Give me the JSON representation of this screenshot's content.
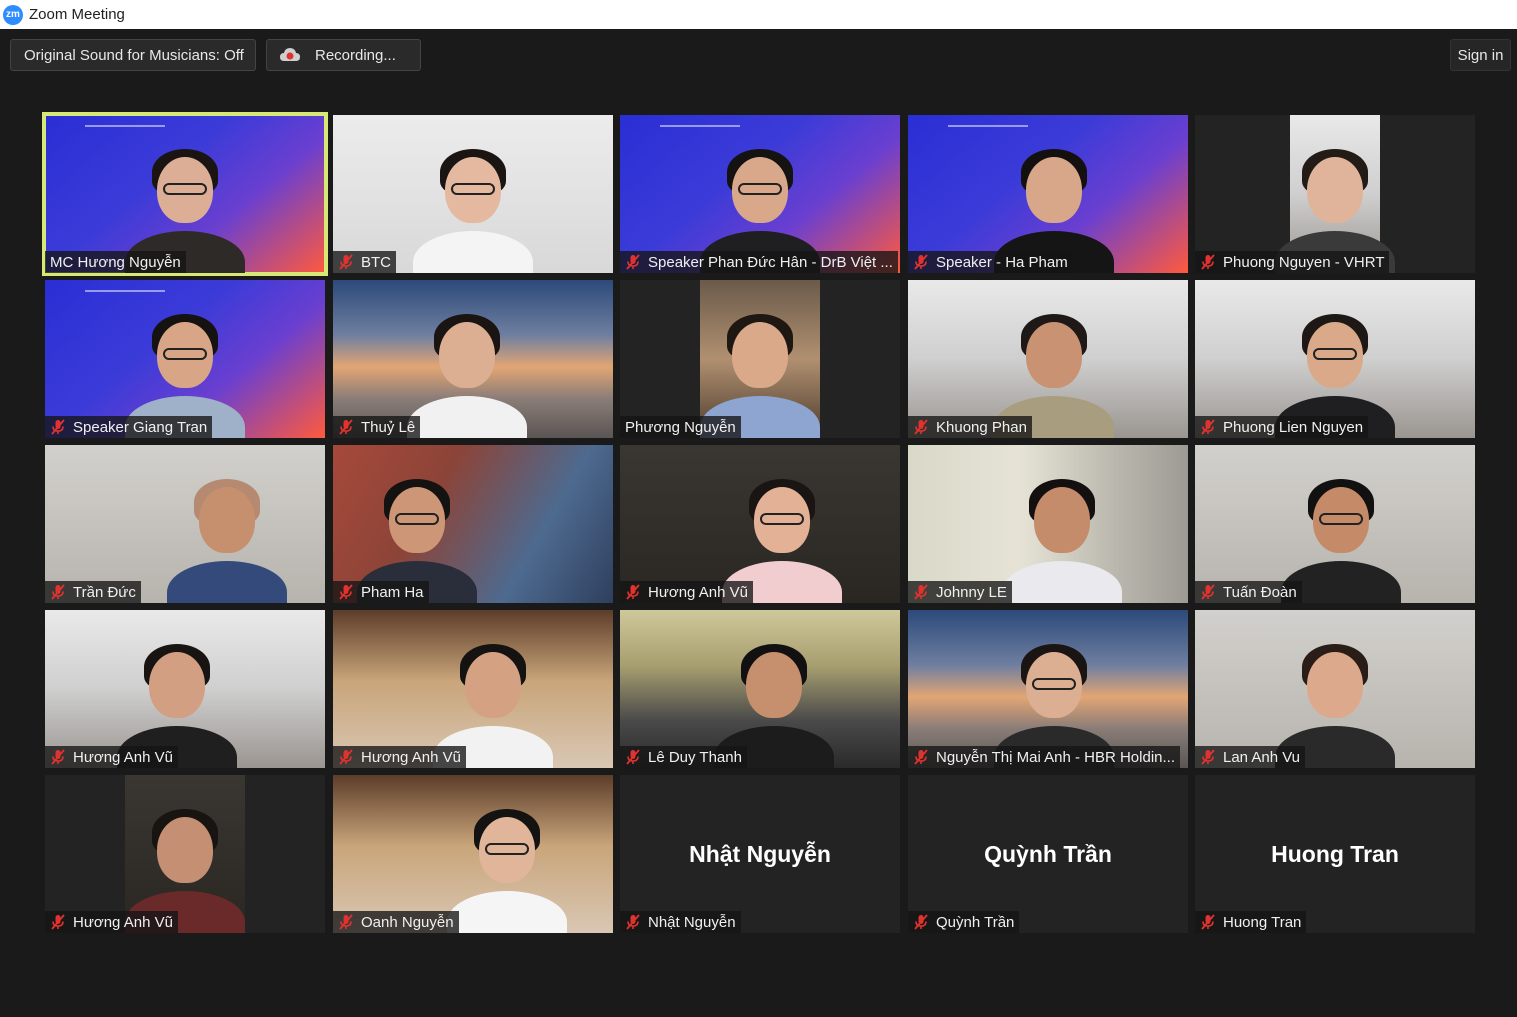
{
  "window": {
    "title": "Zoom Meeting",
    "app_icon": "zm"
  },
  "toolbar": {
    "original_sound": "Original Sound for Musicians: Off",
    "recording": "Recording...",
    "sign_in": "Sign in"
  },
  "participants": [
    {
      "name": "MC Hương Nguyễn",
      "muted": false,
      "active": true
    },
    {
      "name": "BTC",
      "muted": true
    },
    {
      "name": "Speaker Phan Đức Hân - DrB Việt ...",
      "muted": true
    },
    {
      "name": "Speaker - Ha Pham",
      "muted": true
    },
    {
      "name": "Phuong Nguyen - VHRT",
      "muted": true
    },
    {
      "name": "Speaker Giang Tran",
      "muted": true
    },
    {
      "name": "Thuỷ Lê",
      "muted": true
    },
    {
      "name": "Phương Nguyễn",
      "muted": false
    },
    {
      "name": "Khuong Phan",
      "muted": true
    },
    {
      "name": "Phuong Lien Nguyen",
      "muted": true
    },
    {
      "name": "Trần Đức",
      "muted": true
    },
    {
      "name": "Pham Ha",
      "muted": true
    },
    {
      "name": "Hương Anh Vũ",
      "muted": true
    },
    {
      "name": "Johnny LE",
      "muted": true
    },
    {
      "name": "Tuấn Đoàn",
      "muted": true
    },
    {
      "name": "Hương Anh Vũ",
      "muted": true
    },
    {
      "name": "Hương Anh Vũ",
      "muted": true
    },
    {
      "name": "Lê Duy Thanh",
      "muted": true
    },
    {
      "name": "Nguyễn Thị Mai Anh - HBR Holdin...",
      "muted": true
    },
    {
      "name": "Lan Anh Vu",
      "muted": true
    },
    {
      "name": "Hương Anh Vũ",
      "muted": true
    },
    {
      "name": "Oanh Nguyễn",
      "muted": true
    },
    {
      "name": "Nhật Nguyễn",
      "muted": true,
      "video_off": true,
      "center_name": "Nhật Nguyễn"
    },
    {
      "name": "Quỳnh Trần",
      "muted": true,
      "video_off": true,
      "center_name": "Quỳnh Trần"
    },
    {
      "name": "Huong Tran",
      "muted": true,
      "video_off": true,
      "center_name": "Huong Tran"
    }
  ],
  "colors": {
    "active_speaker_border": "#d7e876",
    "muted_icon": "#e0322f",
    "background": "#1a1a1a"
  }
}
